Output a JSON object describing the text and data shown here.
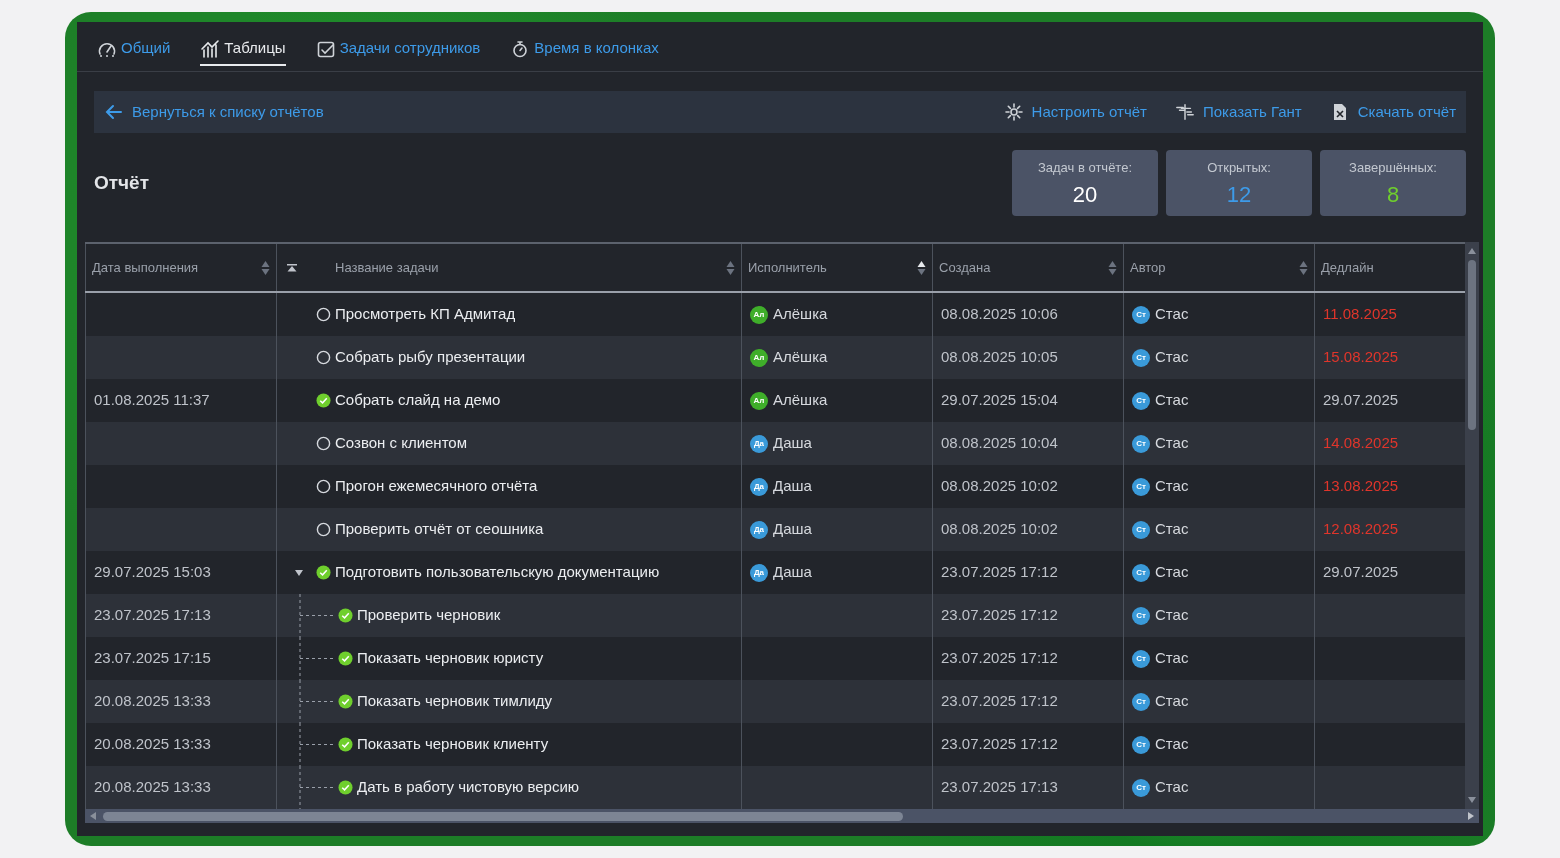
{
  "tabs": [
    {
      "label": "Общий",
      "selected": false
    },
    {
      "label": "Таблицы",
      "selected": true
    },
    {
      "label": "Задачи сотрудников",
      "selected": false
    },
    {
      "label": "Время в колонках",
      "selected": false
    }
  ],
  "toolbar": {
    "back_link": "Вернуться к списку отчётов",
    "actions": [
      {
        "label": "Настроить отчёт"
      },
      {
        "label": "Показать Гант"
      },
      {
        "label": "Скачать отчёт"
      }
    ]
  },
  "title": "Отчёт",
  "stats": [
    {
      "label": "Задач в отчёте:",
      "value": "20",
      "kind": "total"
    },
    {
      "label": "Открытых:",
      "value": "12",
      "kind": "open"
    },
    {
      "label": "Завершённых:",
      "value": "8",
      "kind": "done"
    }
  ],
  "table": {
    "columns": [
      {
        "label": "Дата выполнения",
        "sortable": true,
        "sort_ascending": false
      },
      {
        "label": "Название задачи",
        "sortable": true,
        "sort_ascending": false
      },
      {
        "label": "Исполнитель",
        "sortable": true,
        "sort_ascending": true
      },
      {
        "label": "Создана",
        "sortable": true,
        "sort_ascending": false
      },
      {
        "label": "Автор",
        "sortable": true,
        "sort_ascending": false
      },
      {
        "label": "Дедлайн",
        "sortable": false
      }
    ],
    "rows": [
      {
        "title": "Просмотреть КП Адмитад",
        "done": false,
        "assignee": {
          "initials": "Ал",
          "name": "Алёшка",
          "color": "#3fae2a"
        },
        "created": "08.08.2025 10:06",
        "author": {
          "initials": "Ст",
          "name": "Стас",
          "color": "#3a9ad9"
        },
        "deadline": "11.08.2025",
        "overdue": true
      },
      {
        "title": "Собрать рыбу презентации",
        "done": false,
        "assignee": {
          "initials": "Ал",
          "name": "Алёшка",
          "color": "#3fae2a"
        },
        "created": "08.08.2025 10:05",
        "author": {
          "initials": "Ст",
          "name": "Стас",
          "color": "#3a9ad9"
        },
        "deadline": "15.08.2025",
        "overdue": true
      },
      {
        "completed_at": "01.08.2025 11:37",
        "title": "Собрать слайд на демо",
        "done": true,
        "assignee": {
          "initials": "Ал",
          "name": "Алёшка",
          "color": "#3fae2a"
        },
        "created": "29.07.2025 15:04",
        "author": {
          "initials": "Ст",
          "name": "Стас",
          "color": "#3a9ad9"
        },
        "deadline": "29.07.2025",
        "overdue": false
      },
      {
        "title": "Созвон с клиентом",
        "done": false,
        "assignee": {
          "initials": "Да",
          "name": "Даша",
          "color": "#3a9ad9"
        },
        "created": "08.08.2025 10:04",
        "author": {
          "initials": "Ст",
          "name": "Стас",
          "color": "#3a9ad9"
        },
        "deadline": "14.08.2025",
        "overdue": true
      },
      {
        "title": "Прогон ежемесячного отчёта",
        "done": false,
        "assignee": {
          "initials": "Да",
          "name": "Даша",
          "color": "#3a9ad9"
        },
        "created": "08.08.2025 10:02",
        "author": {
          "initials": "Ст",
          "name": "Стас",
          "color": "#3a9ad9"
        },
        "deadline": "13.08.2025",
        "overdue": true
      },
      {
        "title": "Проверить отчёт от сеошника",
        "done": false,
        "assignee": {
          "initials": "Да",
          "name": "Даша",
          "color": "#3a9ad9"
        },
        "created": "08.08.2025 10:02",
        "author": {
          "initials": "Ст",
          "name": "Стас",
          "color": "#3a9ad9"
        },
        "deadline": "12.08.2025",
        "overdue": true
      },
      {
        "completed_at": "29.07.2025 15:03",
        "title": "Подготовить пользовательскую документацию",
        "done": true,
        "expanded": true,
        "assignee": {
          "initials": "Да",
          "name": "Даша",
          "color": "#3a9ad9"
        },
        "created": "23.07.2025 17:12",
        "author": {
          "initials": "Ст",
          "name": "Стас",
          "color": "#3a9ad9"
        },
        "deadline": "29.07.2025",
        "overdue": false,
        "children": [
          {
            "completed_at": "23.07.2025 17:13",
            "title": "Проверить черновик",
            "done": true,
            "created": "23.07.2025 17:12",
            "author": {
              "initials": "Ст",
              "name": "Стас",
              "color": "#3a9ad9"
            }
          },
          {
            "completed_at": "23.07.2025 17:15",
            "title": "Показать черновик юристу",
            "done": true,
            "created": "23.07.2025 17:12",
            "author": {
              "initials": "Ст",
              "name": "Стас",
              "color": "#3a9ad9"
            }
          },
          {
            "completed_at": "20.08.2025 13:33",
            "title": "Показать черновик тимлиду",
            "done": true,
            "created": "23.07.2025 17:12",
            "author": {
              "initials": "Ст",
              "name": "Стас",
              "color": "#3a9ad9"
            }
          },
          {
            "completed_at": "20.08.2025 13:33",
            "title": "Показать черновик клиенту",
            "done": true,
            "created": "23.07.2025 17:12",
            "author": {
              "initials": "Ст",
              "name": "Стас",
              "color": "#3a9ad9"
            }
          },
          {
            "completed_at": "20.08.2025 13:33",
            "title": "Дать в работу чистовую версию",
            "done": true,
            "created": "23.07.2025 17:13",
            "author": {
              "initials": "Ст",
              "name": "Стас",
              "color": "#3a9ad9"
            }
          }
        ]
      }
    ]
  }
}
